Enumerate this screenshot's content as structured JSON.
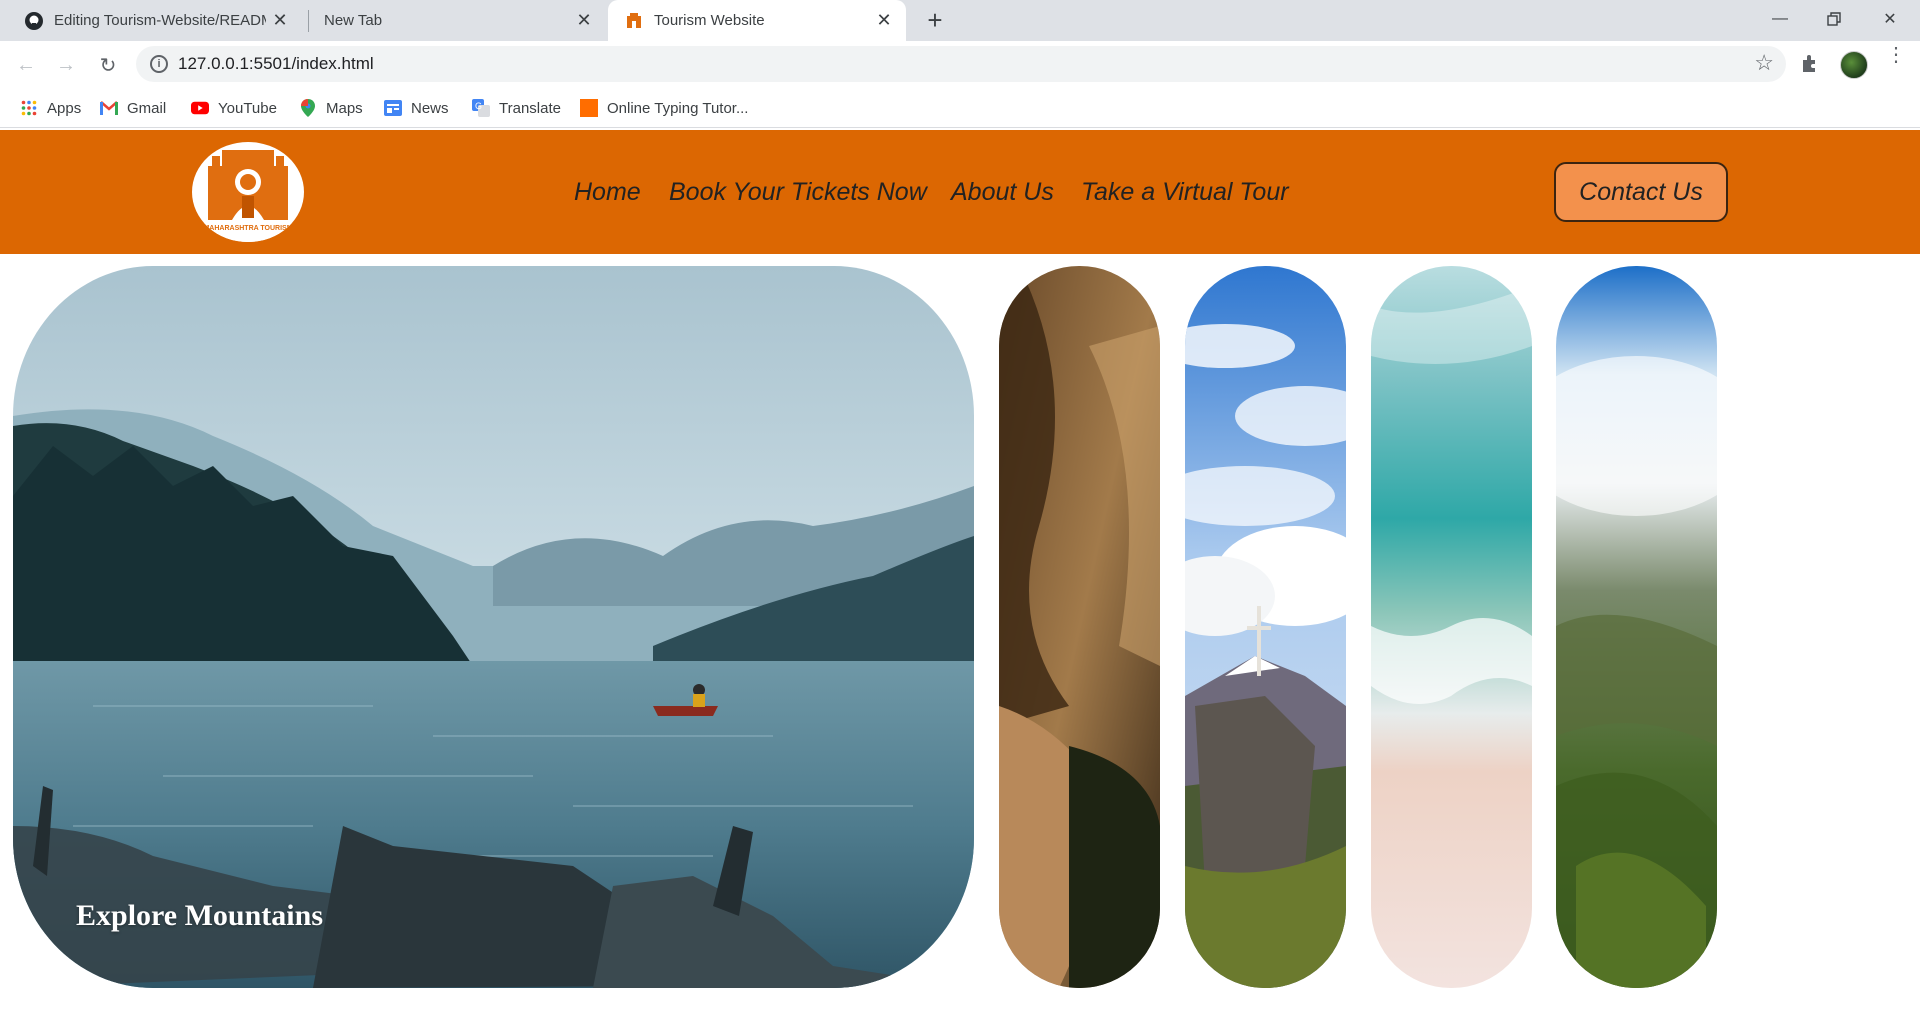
{
  "browser": {
    "tabs": [
      {
        "title": "Editing Tourism-Website/README",
        "icon": "github-icon",
        "active": false
      },
      {
        "title": "New Tab",
        "icon": "",
        "active": false
      },
      {
        "title": "Tourism Website",
        "icon": "temple-favicon",
        "active": true
      }
    ],
    "url": "127.0.0.1:5501/index.html",
    "bookmarks": [
      {
        "label": "Apps",
        "icon": "apps-grid-icon"
      },
      {
        "label": "Gmail",
        "icon": "gmail-icon"
      },
      {
        "label": "YouTube",
        "icon": "youtube-icon"
      },
      {
        "label": "Maps",
        "icon": "maps-pin-icon"
      },
      {
        "label": "News",
        "icon": "news-icon"
      },
      {
        "label": "Translate",
        "icon": "translate-icon"
      },
      {
        "label": "Online Typing Tutor...",
        "icon": "typing-tutor-icon"
      }
    ]
  },
  "site": {
    "logo_text": "MAHARASHTRA TOURISM",
    "nav": [
      "Home",
      "Book Your Tickets Now",
      "About Us",
      "Take a Virtual Tour"
    ],
    "contact_label": "Contact Us",
    "hero_caption": "Explore Mountains",
    "colors": {
      "header": "#dc6702",
      "contact_button": "#f3914c"
    }
  }
}
